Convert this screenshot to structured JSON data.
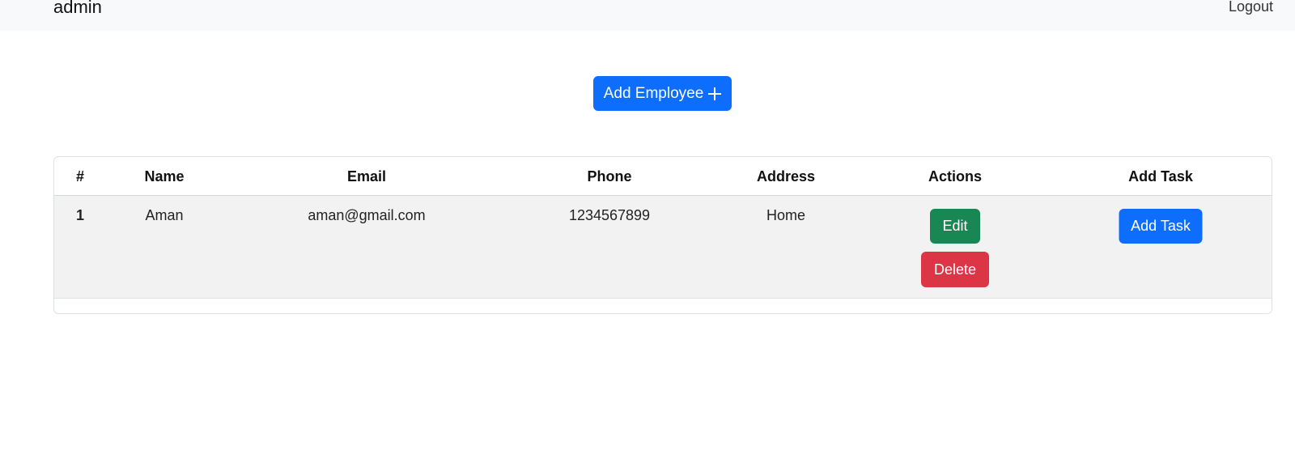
{
  "navbar": {
    "brand": "admin",
    "logout_label": "Logout"
  },
  "add_employee": {
    "label": "Add Employee",
    "icon": "plus-icon"
  },
  "table": {
    "columns": [
      "#",
      "Name",
      "Email",
      "Phone",
      "Address",
      "Actions",
      "Add Task"
    ],
    "rows": [
      {
        "index": "1",
        "name": "Aman",
        "email": "aman@gmail.com",
        "phone": "1234567899",
        "address": "Home",
        "edit_label": "Edit",
        "delete_label": "Delete",
        "add_task_label": "Add Task"
      }
    ]
  },
  "colors": {
    "primary": "#0d6efd",
    "success": "#198754",
    "danger": "#dc3545",
    "navbar_bg": "#f8f9fa",
    "row_bg": "#f2f2f2"
  }
}
